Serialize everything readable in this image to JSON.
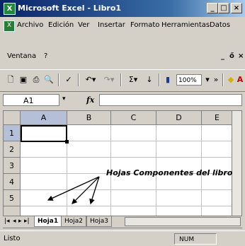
{
  "window": {
    "title": "Microsoft Excel - Libro1",
    "app_icon": "excel-icon"
  },
  "menu": [
    "Archivo",
    "Edición",
    "Ver",
    "Insertar",
    "Formato",
    "Herramientas",
    "Datos",
    "Ventana",
    "?"
  ],
  "toolbar": {
    "zoom": "100%",
    "sum": "Σ",
    "font_color": "A"
  },
  "formula_bar": {
    "cell_ref": "A1",
    "fx": "fx"
  },
  "grid": {
    "columns": [
      "A",
      "B",
      "C",
      "D",
      "E"
    ],
    "rows": [
      "1",
      "2",
      "3",
      "4",
      "5"
    ],
    "active_cell": "A1"
  },
  "annotation": "Hojas Componentes del libro",
  "sheet_tabs": [
    "Hoja1",
    "Hoja2",
    "Hoja3"
  ],
  "active_sheet": "Hoja1",
  "status": {
    "text": "Listo",
    "num": "NUM"
  }
}
